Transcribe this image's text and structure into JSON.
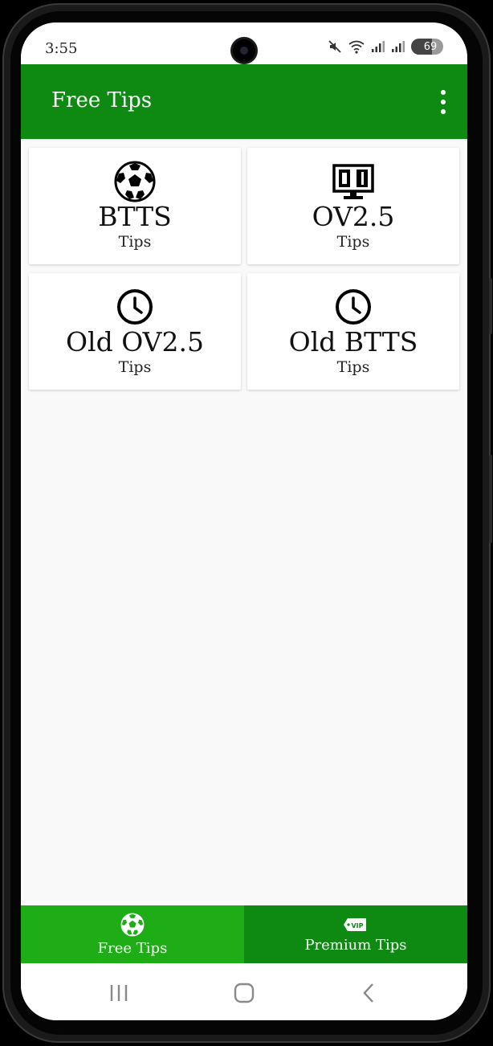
{
  "status_bar": {
    "time": "3:55",
    "battery": "69"
  },
  "app_bar": {
    "title": "Free Tips"
  },
  "cards": [
    {
      "title": "BTTS",
      "subtitle": "Tips",
      "icon": "soccer-ball-icon"
    },
    {
      "title": "OV2.5",
      "subtitle": "Tips",
      "icon": "scoreboard-icon"
    },
    {
      "title": "Old OV2.5",
      "subtitle": "Tips",
      "icon": "clock-icon"
    },
    {
      "title": "Old BTTS",
      "subtitle": "Tips",
      "icon": "clock-icon"
    }
  ],
  "bottom_nav": {
    "items": [
      {
        "label": "Free Tips",
        "icon": "soccer-ball-icon",
        "active": true
      },
      {
        "label": "Premium Tips",
        "icon": "vip-ticket-icon",
        "active": false
      }
    ]
  },
  "colors": {
    "app_bar": "#0e8a13",
    "nav_active": "#1fad17",
    "nav_inactive": "#0e8a13"
  }
}
